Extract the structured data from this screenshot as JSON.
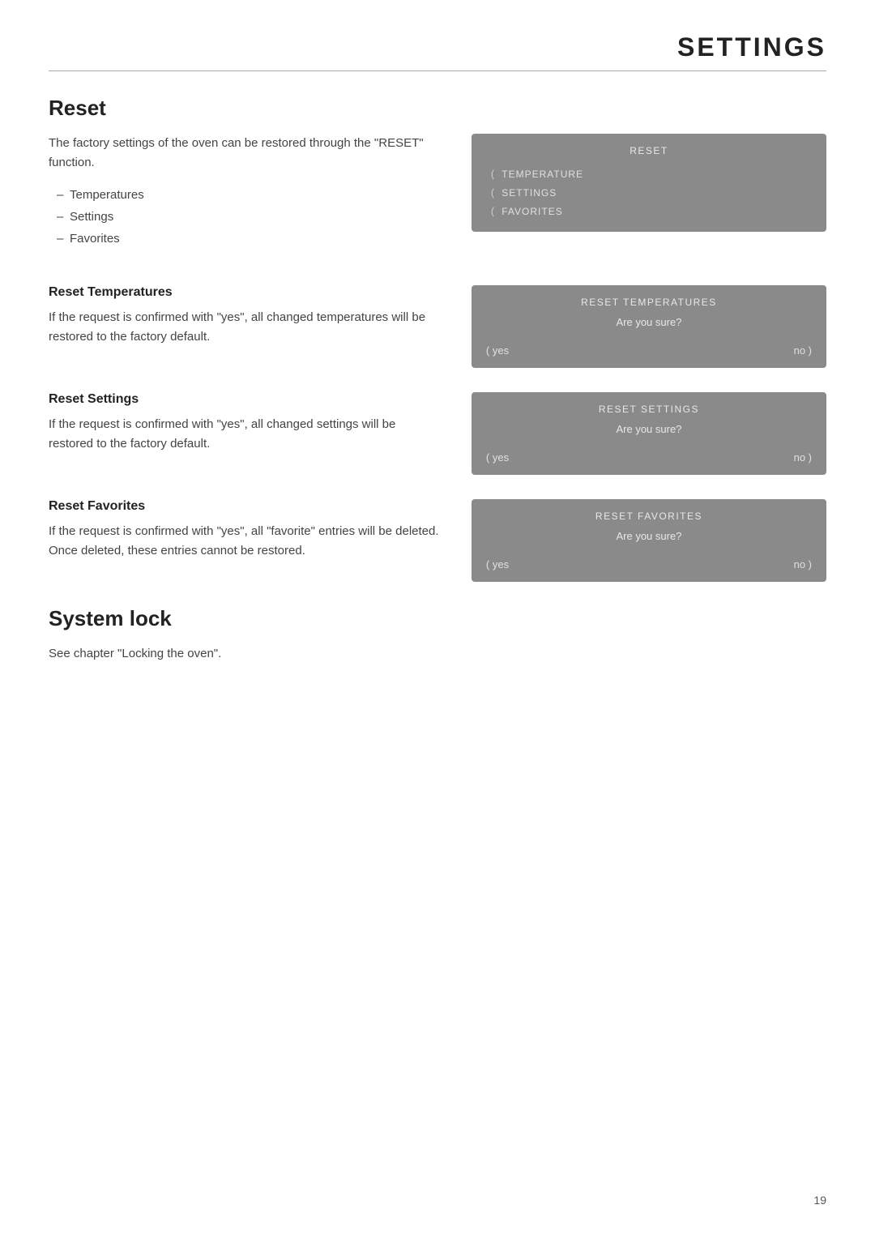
{
  "header": {
    "title": "SETTINGS"
  },
  "reset_section": {
    "title": "Reset",
    "intro_text": "The factory settings of the oven can be restored through the \"RESET\" function.",
    "bullets": [
      "Temperatures",
      "Settings",
      "Favorites"
    ],
    "panel": {
      "title": "RESET",
      "items": [
        "TEMPERATURE",
        "SETTINGS",
        "FAVORITES"
      ]
    }
  },
  "reset_temperatures": {
    "subtitle": "Reset Temperatures",
    "body_text": "If the request is confirmed with \"yes\", all changed temperatures will be restored to the factory default.",
    "panel": {
      "title": "RESET TEMPERATURES",
      "subtitle": "Are you sure?",
      "yes_label": "( yes",
      "no_label": "no )"
    }
  },
  "reset_settings": {
    "subtitle": "Reset Settings",
    "body_text": "If the request is confirmed with \"yes\", all changed settings will be restored to the factory default.",
    "panel": {
      "title": "RESET  SETTINGS",
      "subtitle": "Are you sure?",
      "yes_label": "( yes",
      "no_label": "no )"
    }
  },
  "reset_favorites": {
    "subtitle": "Reset Favorites",
    "body_text": "If the request is confirmed with \"yes\", all \"favorite\" entries will be deleted. Once deleted, these entries cannot be restored.",
    "panel": {
      "title": "RESET FAVORITES",
      "subtitle": "Are you sure?",
      "yes_label": "( yes",
      "no_label": "no )"
    }
  },
  "system_lock": {
    "title": "System lock",
    "body_text": "See chapter \"Locking the oven\"."
  },
  "page_number": "19"
}
